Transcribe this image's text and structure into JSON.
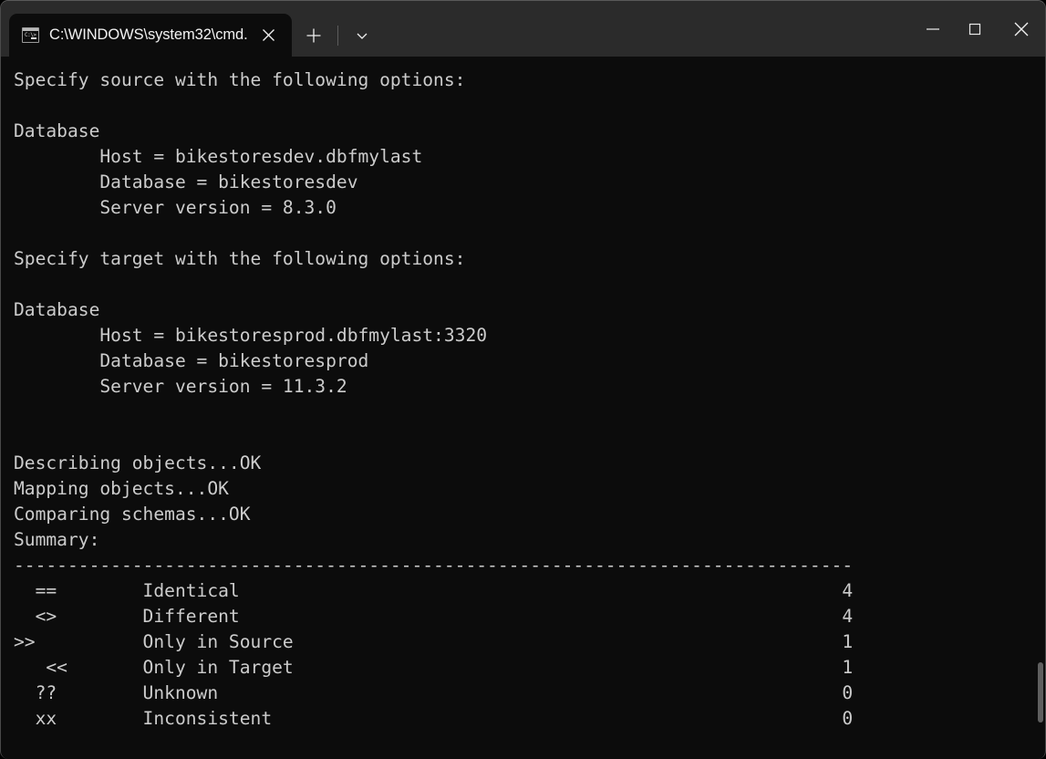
{
  "window": {
    "tab": {
      "title": "C:\\WINDOWS\\system32\\cmd.",
      "icon": "console-icon",
      "prompt_glyph": "C:\\>",
      "close_label": "✕"
    },
    "new_tab_label": "+",
    "tab_menu_label": "⌄",
    "caption": {
      "minimize_label": "—",
      "maximize_label": "□",
      "close_label": "✕"
    },
    "colors": {
      "titlebar_bg": "#2b2b2b",
      "terminal_bg": "#0c0c0c",
      "text": "#cccccc",
      "tab_active_bg": "#0c0c0c"
    }
  },
  "terminal": {
    "lines": [
      "Specify source with the following options:",
      "",
      "Database",
      "        Host = bikestoresdev.dbfmylast",
      "        Database = bikestoresdev",
      "        Server version = 8.3.0",
      "",
      "Specify target with the following options:",
      "",
      "Database",
      "        Host = bikestoresprod.dbfmylast:3320",
      "        Database = bikestoresprod",
      "        Server version = 11.3.2",
      "",
      "",
      "Describing objects...OK",
      "Mapping objects...OK",
      "Comparing schemas...OK",
      "Summary:",
      "------------------------------------------------------------------------------",
      "  ==        Identical                                                        4",
      "  <>        Different                                                        4",
      ">>          Only in Source                                                   1",
      "   <<       Only in Target                                                   1",
      "  ??        Unknown                                                          0",
      "  xx        Inconsistent                                                     0"
    ],
    "source": {
      "heading": "Specify source with the following options:",
      "section": "Database",
      "host_label": "Host",
      "host": "bikestoresdev.dbfmylast",
      "database_label": "Database",
      "database": "bikestoresdev",
      "server_version_label": "Server version",
      "server_version": "8.3.0"
    },
    "target": {
      "heading": "Specify target with the following options:",
      "section": "Database",
      "host_label": "Host",
      "host": "bikestoresprod.dbfmylast:3320",
      "database_label": "Database",
      "database": "bikestoresprod",
      "server_version_label": "Server version",
      "server_version": "11.3.2"
    },
    "progress": [
      "Describing objects...OK",
      "Mapping objects...OK",
      "Comparing schemas...OK"
    ],
    "summary_label": "Summary:",
    "summary_rows": [
      {
        "symbol": "==",
        "label": "Identical",
        "count": "4"
      },
      {
        "symbol": "<>",
        "label": "Different",
        "count": "4"
      },
      {
        "symbol": ">>",
        "label": "Only in Source",
        "count": "1"
      },
      {
        "symbol": "<<",
        "label": "Only in Target",
        "count": "1"
      },
      {
        "symbol": "??",
        "label": "Unknown",
        "count": "0"
      },
      {
        "symbol": "xx",
        "label": "Inconsistent",
        "count": "0"
      }
    ]
  }
}
